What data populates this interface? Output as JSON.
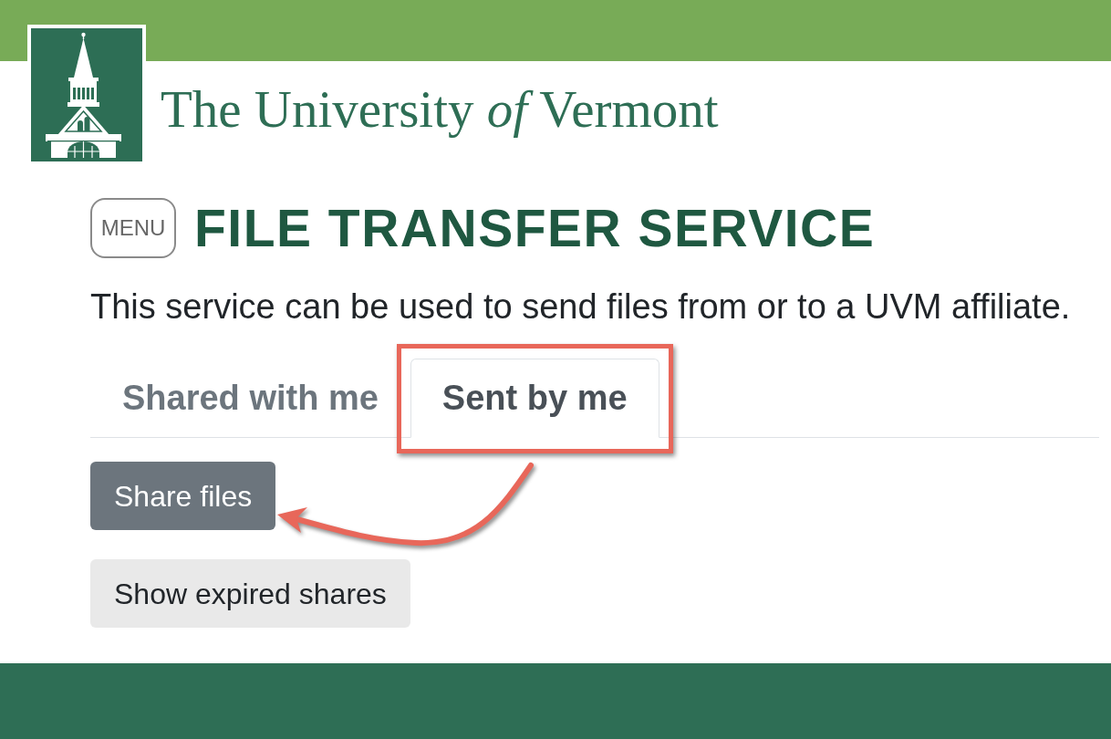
{
  "header": {
    "wordmark": "The University *of* Vermont"
  },
  "page": {
    "menu_button": "MENU",
    "title": "FILE TRANSFER SERVICE",
    "description": "This service can be used to send files from or to a UVM affiliate."
  },
  "tabs": [
    {
      "label": "Shared with me",
      "selected": false,
      "highlighted": false
    },
    {
      "label": "Sent by me",
      "selected": true,
      "highlighted": true
    }
  ],
  "buttons": [
    {
      "label": "Share files",
      "kind": "primary"
    },
    {
      "label": "Show expired shares",
      "kind": "secondary"
    }
  ]
}
